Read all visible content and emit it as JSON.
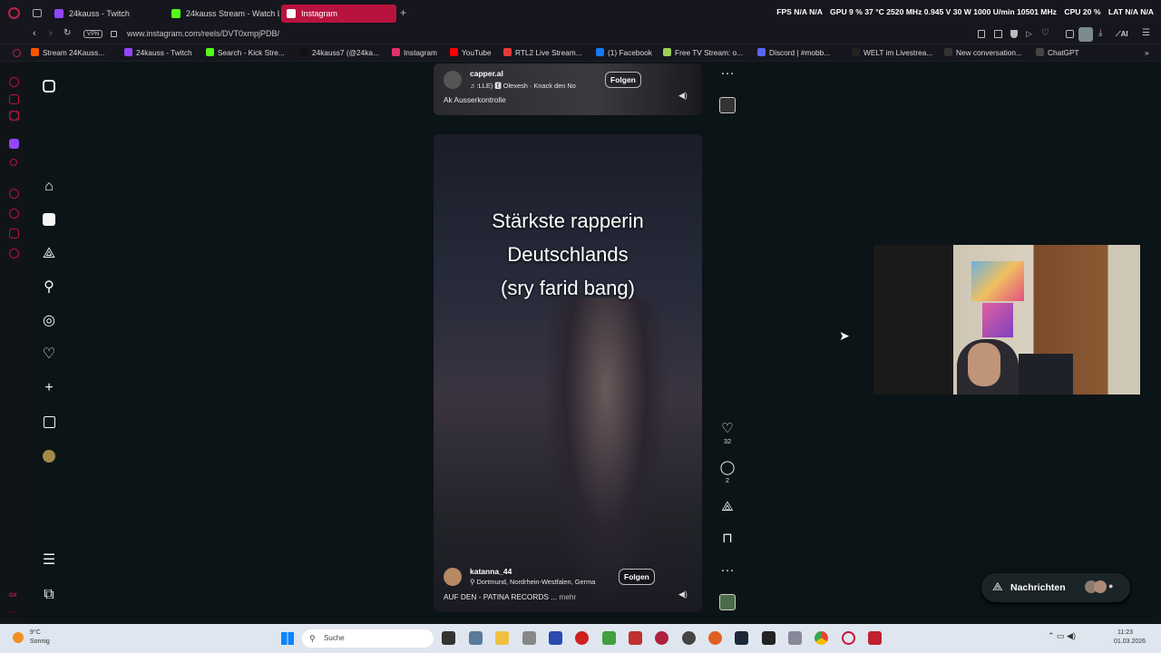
{
  "browser": {
    "tabs": [
      {
        "label": "24kauss - Twitch",
        "color": "#9146ff"
      },
      {
        "label": "24kauss Stream - Watch L",
        "color": "#53fc18"
      },
      {
        "label": "Instagram",
        "color": "#e1306c",
        "active": true
      }
    ],
    "stats": {
      "fps": "FPS  N/A  N/A",
      "gpu": "GPU  9 %  37 °C  2520 MHz  0.945 V  30 W  1000 U/min  10501 MHz",
      "cpu": "CPU  20 %",
      "lat": "LAT  N/A  N/A"
    },
    "vpn_label": "VPN",
    "url": "www.instagram.com/reels/DVT0xmpjPDB/",
    "bookmarks": [
      {
        "label": "Stream 24Kauss...",
        "color": "#ff5500"
      },
      {
        "label": "24kauss - Twitch",
        "color": "#9146ff"
      },
      {
        "label": "Search - Kick Stre...",
        "color": "#53fc18"
      },
      {
        "label": "24kauss7 (@24ka...",
        "color": "#111111"
      },
      {
        "label": "Instagram",
        "color": "#e1306c"
      },
      {
        "label": "YouTube",
        "color": "#ff0000"
      },
      {
        "label": "RTL2 Live Stream...",
        "color": "#e53935"
      },
      {
        "label": "(1) Facebook",
        "color": "#1877f2"
      },
      {
        "label": "Free TV Stream: o...",
        "color": "#9bd35a"
      },
      {
        "label": "Discord | #mobb...",
        "color": "#5865f2"
      },
      {
        "label": "WELT im Livestrea...",
        "color": "#222222"
      },
      {
        "label": "New conversation...",
        "color": "#333333"
      },
      {
        "label": "ChatGPT",
        "color": "#444444"
      }
    ]
  },
  "instagram": {
    "nav_icons": [
      "instagram-logo-icon",
      "home-icon",
      "reels-icon",
      "messages-icon",
      "search-icon",
      "explore-icon",
      "notifications-icon",
      "create-icon",
      "dashboard-icon",
      "profile-avatar",
      "menu-icon",
      "more-apps-icon"
    ],
    "reel_top": {
      "username": "capper.al",
      "music": "♫  :LLE)  🅴  Olexesh · Knack den No",
      "caption": "Ak Ausserkontrolle",
      "follow": "Folgen"
    },
    "reel_main": {
      "overlay_lines": [
        "Stärkste rapperin",
        "Deutschlands",
        "(sry farid bang)"
      ],
      "username": "katanna_44",
      "location": "Dortmund, Nordrhein-Westfalen, Germa",
      "caption": "AUF DEN - PATINA RECORDS ...",
      "more": "mehr",
      "follow": "Folgen"
    },
    "actions": {
      "likes": "32",
      "comments": "2"
    },
    "messages_label": "Nachrichten"
  },
  "taskbar": {
    "weather_temp": "9°C",
    "weather_desc": "Sonnig",
    "search_placeholder": "Suche",
    "time": "11:23",
    "date": "01.03.2026"
  }
}
